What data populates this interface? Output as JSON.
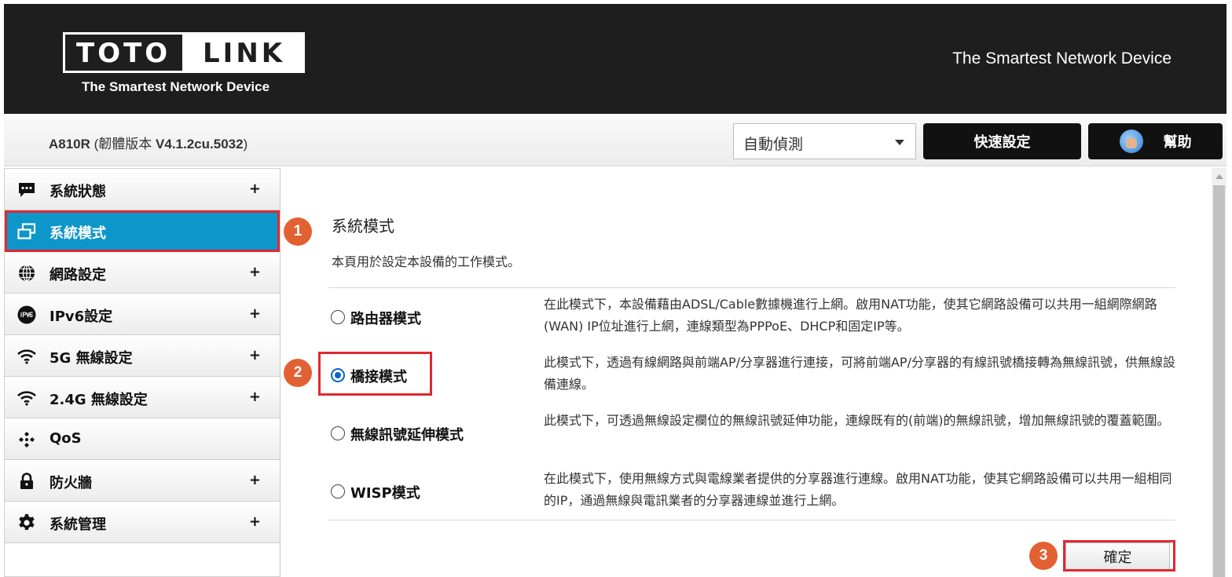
{
  "header": {
    "logo_left": "TOTO",
    "logo_right": "LINK",
    "logo_tagline": "The Smartest Network Device",
    "tagline": "The Smartest Network Device"
  },
  "topbar": {
    "model_name": "A810R",
    "firmware_label": " (韌體版本 ",
    "firmware_version": "V4.1.2cu.5032",
    "firmware_close": ")",
    "language_selected": "自動偵測",
    "quick_setup_label": "快速設定",
    "help_label": "幫助"
  },
  "sidebar": {
    "items": [
      {
        "label": "系統狀態",
        "icon": "chat-bubble-icon",
        "expand": "+"
      },
      {
        "label": "系統模式",
        "icon": "windows-icon",
        "expand": ""
      },
      {
        "label": "網路設定",
        "icon": "globe-icon",
        "expand": "+"
      },
      {
        "label": "IPv6設定",
        "icon": "ipv6-icon",
        "expand": "+"
      },
      {
        "label": "5G 無線設定",
        "icon": "wifi-icon",
        "expand": "+"
      },
      {
        "label": "2.4G 無線設定",
        "icon": "wifi-icon",
        "expand": "+"
      },
      {
        "label": "QoS",
        "icon": "qos-icon",
        "expand": ""
      },
      {
        "label": "防火牆",
        "icon": "lock-icon",
        "expand": "+"
      },
      {
        "label": "系統管理",
        "icon": "gear-icon",
        "expand": "+"
      }
    ]
  },
  "main": {
    "title": "系統模式",
    "description": "本頁用於設定本設備的工作模式。",
    "modes": [
      {
        "label": "路由器模式",
        "checked": false,
        "description": "在此模式下，本設備藉由ADSL/Cable數據機進行上網。啟用NAT功能，使其它網路設備可以共用一組網際網路(WAN) IP位址進行上網，連線類型為PPPoE、DHCP和固定IP等。"
      },
      {
        "label": "橋接模式",
        "checked": true,
        "description": "此模式下，透過有線網路與前端AP/分享器進行連接，可將前端AP/分享器的有線訊號橋接轉為無線訊號，供無線設備連線。"
      },
      {
        "label": "無線訊號延伸模式",
        "checked": false,
        "description": "此模式下，可透過無線設定欄位的無線訊號延伸功能，連線既有的(前端)的無線訊號，增加無線訊號的覆蓋範圍。"
      },
      {
        "label": "WISP模式",
        "checked": false,
        "description": "在此模式下，使用無線方式與電線業者提供的分享器進行連線。啟用NAT功能，使其它網路設備可以共用一組相同的IP，通過無線與電訊業者的分享器連線並進行上網。"
      }
    ],
    "confirm_label": "確定"
  },
  "annotations": {
    "step1": "1",
    "step2": "2",
    "step3": "3"
  },
  "colors": {
    "accent": "#0d96c9",
    "highlight": "#e0282f",
    "badge": "#e26132",
    "header_bg": "#1e1e1e"
  }
}
